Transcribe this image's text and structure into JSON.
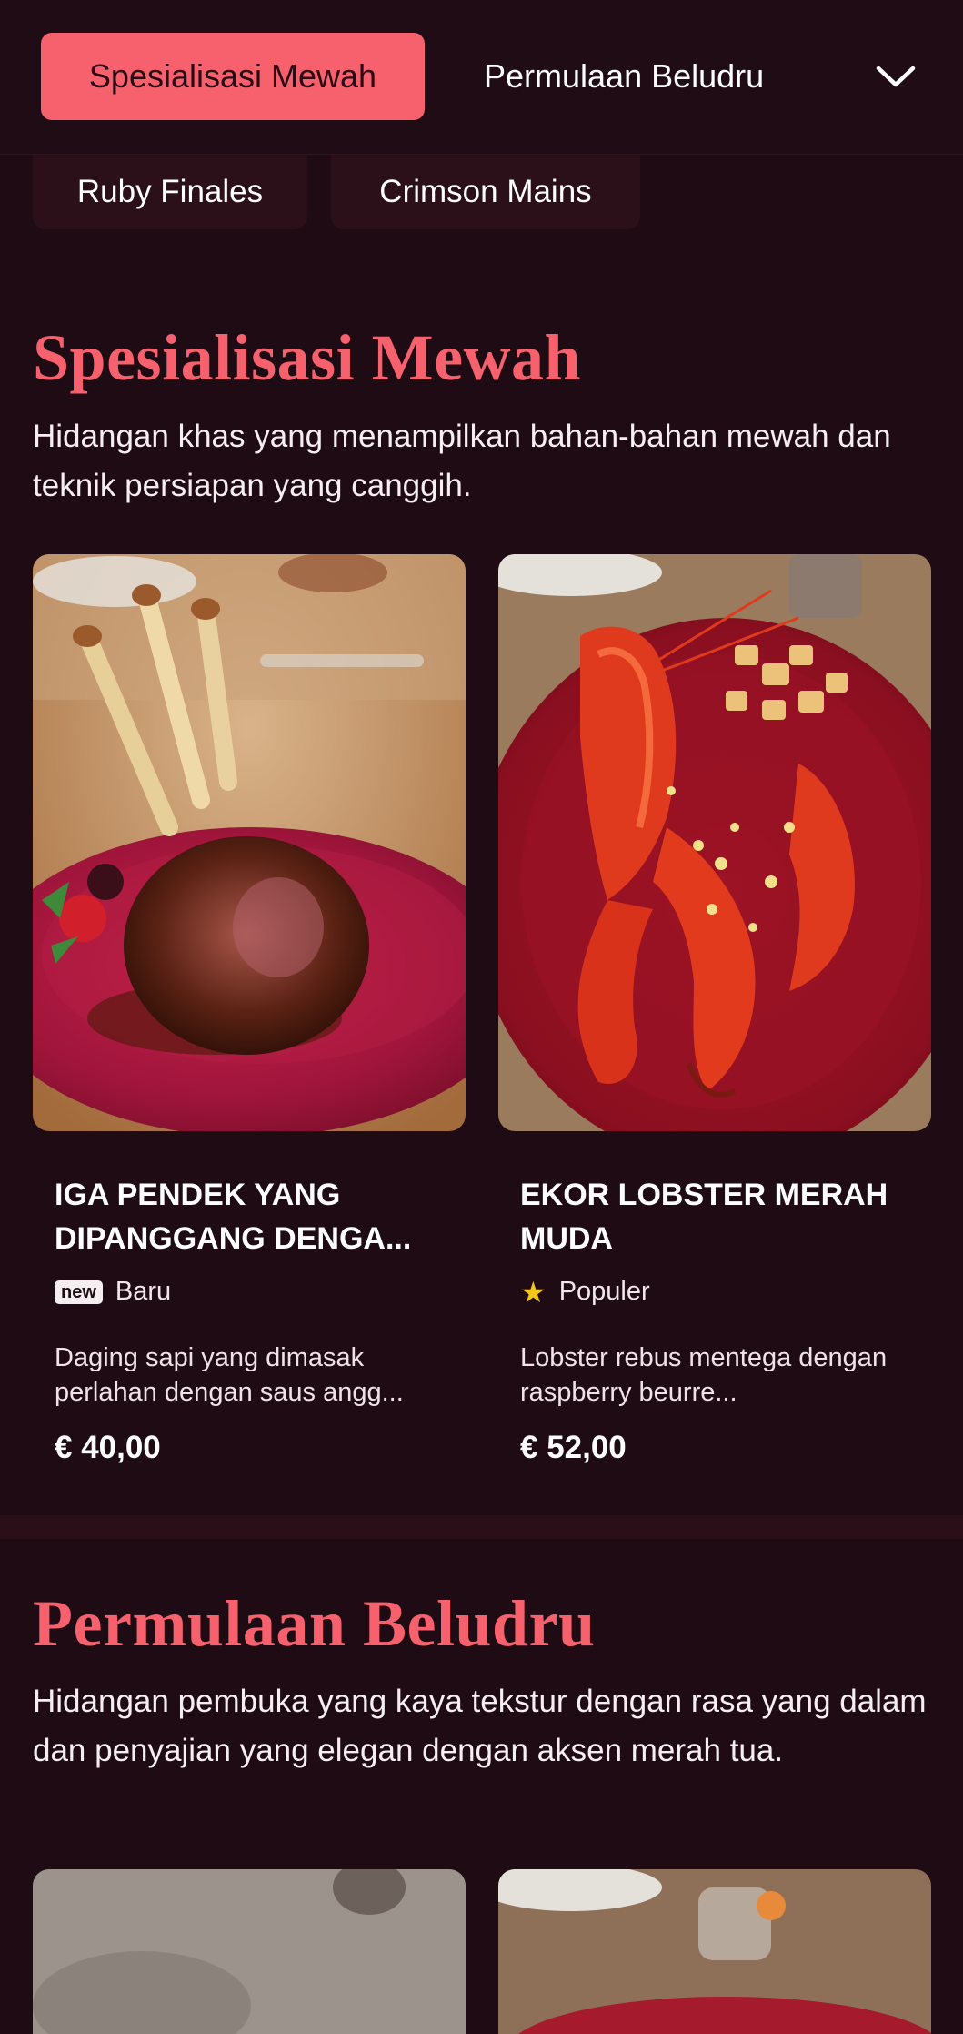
{
  "nav": {
    "active_tab": "Spesialisasi Mewah",
    "second_tab": "Permulaan Beludru",
    "more_icon": "chevron-down-icon"
  },
  "chips": [
    "Ruby Finales",
    "Crimson Mains"
  ],
  "sections": [
    {
      "title": "Spesialisasi Mewah",
      "description": "Hidangan khas yang menampilkan bahan-bahan mewah dan teknik persiapan yang canggih.",
      "items": [
        {
          "name": "IGA PENDEK YANG DIPANGGANG DENGA...",
          "badge_type": "new",
          "badge_icon_text": "new",
          "badge_label": "Baru",
          "description": "Daging sapi yang dimasak perlahan dengan saus angg...",
          "price": "€ 40,00"
        },
        {
          "name": "EKOR LOBSTER MERAH MUDA",
          "badge_type": "popular",
          "badge_icon": "star-icon",
          "badge_label": "Populer",
          "description": "Lobster rebus mentega dengan raspberry beurre...",
          "price": "€ 52,00"
        }
      ]
    },
    {
      "title": "Permulaan Beludru",
      "description": "Hidangan pembuka yang kaya tekstur dengan rasa yang dalam dan penyajian yang elegan dengan aksen merah tua."
    }
  ],
  "colors": {
    "background": "#1f0b13",
    "accent": "#f6616d",
    "chip": "#2b1019",
    "star": "#f5c518"
  }
}
